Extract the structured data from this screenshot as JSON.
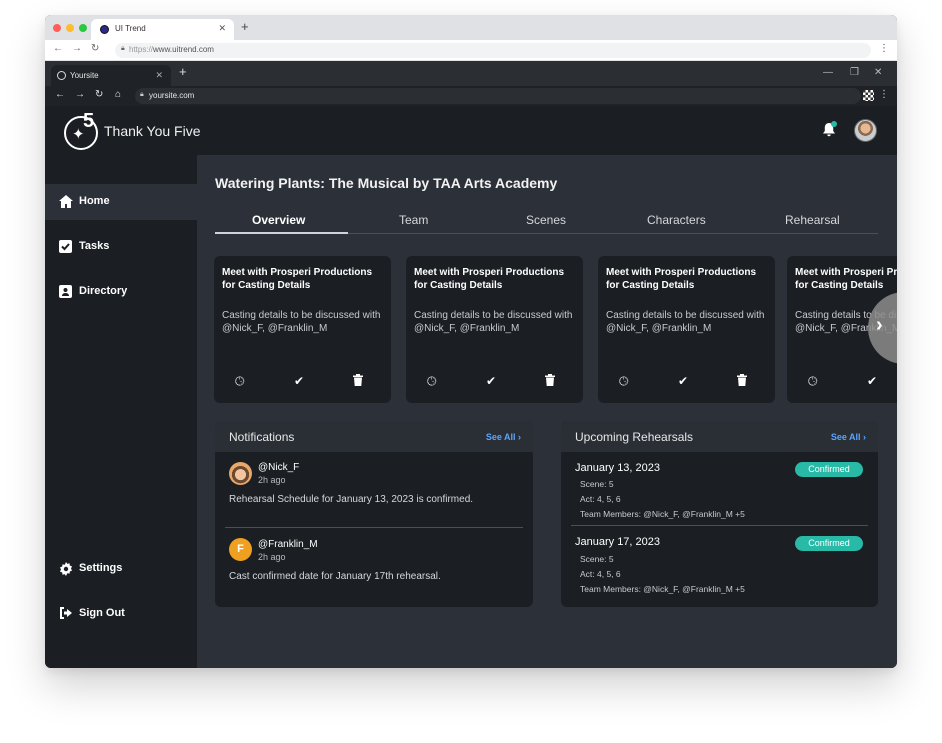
{
  "outer_browser": {
    "tab_title": "UI Trend",
    "url_prefix": "https://",
    "url": "www.uitrend.com"
  },
  "inner_browser": {
    "tab_title": "Yoursite",
    "url": "yoursite.com"
  },
  "app": {
    "logo_digit": "5",
    "brand": "Thank You Five"
  },
  "sidebar": {
    "items": [
      {
        "label": "Home",
        "icon": "home-icon"
      },
      {
        "label": "Tasks",
        "icon": "checkbox-icon"
      },
      {
        "label": "Directory",
        "icon": "contact-card-icon"
      }
    ],
    "bottom_items": [
      {
        "label": "Settings",
        "icon": "gear-icon"
      },
      {
        "label": "Sign Out",
        "icon": "sign-out-icon"
      }
    ]
  },
  "project": {
    "title": "Watering Plants: The Musical by TAA Arts Academy"
  },
  "tabs": [
    "Overview",
    "Team",
    "Scenes",
    "Characters",
    "Rehearsal"
  ],
  "task_cards": [
    {
      "title": "Meet with Prosperi Productions for Casting Details",
      "desc": "Casting details to be discussed with @Nick_F, @Franklin_M"
    },
    {
      "title": "Meet with Prosperi Productions for Casting Details",
      "desc": "Casting details to be discussed with @Nick_F, @Franklin_M"
    },
    {
      "title": "Meet with Prosperi Productions for Casting Details",
      "desc": "Casting details to be discussed with @Nick_F, @Franklin_M"
    },
    {
      "title": "Meet with Prosperi Productions for Casting Details",
      "desc": "Casting details to be discussed with @Nick_F, @Franklin_M"
    }
  ],
  "notifications": {
    "title": "Notifications",
    "see_all": "See All",
    "items": [
      {
        "name": "@Nick_F",
        "time": "2h ago",
        "message": "Rehearsal Schedule for January 13, 2023 is confirmed.",
        "avatar_initial": ""
      },
      {
        "name": "@Franklin_M",
        "time": "2h ago",
        "message": "Cast confirmed date for January 17th rehearsal.",
        "avatar_initial": "F"
      }
    ]
  },
  "rehearsals": {
    "title": "Upcoming Rehearsals",
    "see_all": "See All",
    "items": [
      {
        "date": "January 13, 2023",
        "scene": "Scene: 5",
        "act": "Act: 4, 5, 6",
        "team": "Team Members: @Nick_F, @Franklin_M +5",
        "status": "Confirmed"
      },
      {
        "date": "January 17, 2023",
        "scene": "Scene: 5",
        "act": "Act: 4, 5, 6",
        "team": "Team Members: @Nick_F, @Franklin_M +5",
        "status": "Confirmed"
      }
    ]
  },
  "colors": {
    "accent_teal": "#29b9a7",
    "link_blue": "#5aa5ff",
    "avatar_orange": "#f0a020"
  }
}
